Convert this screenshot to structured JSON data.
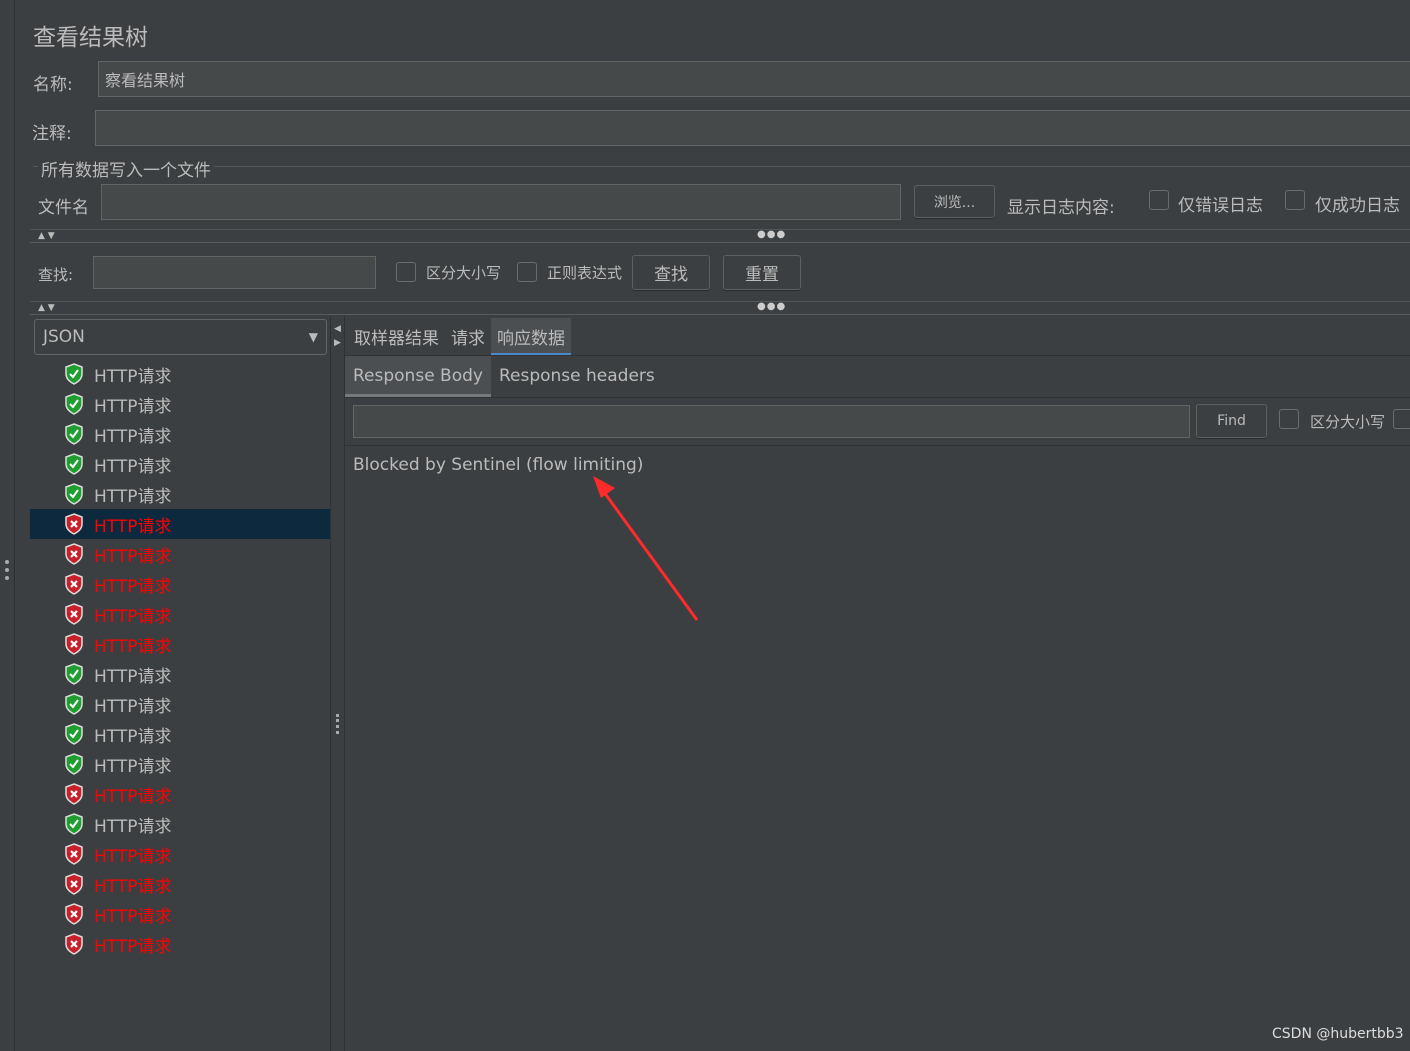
{
  "title": "查看结果树",
  "name": {
    "label": "名称:",
    "value": "察看结果树"
  },
  "comment": {
    "label": "注释:",
    "value": ""
  },
  "file_section": {
    "legend": "所有数据写入一个文件",
    "filename_label": "文件名",
    "filename_value": "",
    "browse": "浏览...",
    "log_label": "显示日志内容:",
    "errors_only": "仅错误日志",
    "success_only": "仅成功日志"
  },
  "search": {
    "label": "查找:",
    "value": "",
    "case_sensitive": "区分大小写",
    "regex": "正则表达式",
    "find": "查找",
    "reset": "重置"
  },
  "renderer": {
    "selected": "JSON"
  },
  "results": [
    {
      "label": "HTTP请求",
      "status": "success"
    },
    {
      "label": "HTTP请求",
      "status": "success"
    },
    {
      "label": "HTTP请求",
      "status": "success"
    },
    {
      "label": "HTTP请求",
      "status": "success"
    },
    {
      "label": "HTTP请求",
      "status": "success"
    },
    {
      "label": "HTTP请求",
      "status": "error",
      "selected": true
    },
    {
      "label": "HTTP请求",
      "status": "error"
    },
    {
      "label": "HTTP请求",
      "status": "error"
    },
    {
      "label": "HTTP请求",
      "status": "error"
    },
    {
      "label": "HTTP请求",
      "status": "error"
    },
    {
      "label": "HTTP请求",
      "status": "success"
    },
    {
      "label": "HTTP请求",
      "status": "success"
    },
    {
      "label": "HTTP请求",
      "status": "success"
    },
    {
      "label": "HTTP请求",
      "status": "success"
    },
    {
      "label": "HTTP请求",
      "status": "error"
    },
    {
      "label": "HTTP请求",
      "status": "success"
    },
    {
      "label": "HTTP请求",
      "status": "error"
    },
    {
      "label": "HTTP请求",
      "status": "error"
    },
    {
      "label": "HTTP请求",
      "status": "error"
    },
    {
      "label": "HTTP请求",
      "status": "error"
    }
  ],
  "tabs": [
    {
      "label": "取样器结果"
    },
    {
      "label": "请求"
    },
    {
      "label": "响应数据",
      "active": true
    }
  ],
  "subtabs": [
    {
      "label": "Response Body",
      "active": true
    },
    {
      "label": "Response headers"
    }
  ],
  "response_search": {
    "value": "",
    "find": "Find",
    "case_sensitive": "区分大小写"
  },
  "response_body": "Blocked by Sentinel (flow limiting)",
  "watermark": "CSDN @hubertbb3",
  "colors": {
    "background": "#3c3f41",
    "error_text": "#ff0000",
    "selected_row": "#0d293e",
    "active_tab": "#4a88c7",
    "arrow": "#ff2a2a"
  }
}
